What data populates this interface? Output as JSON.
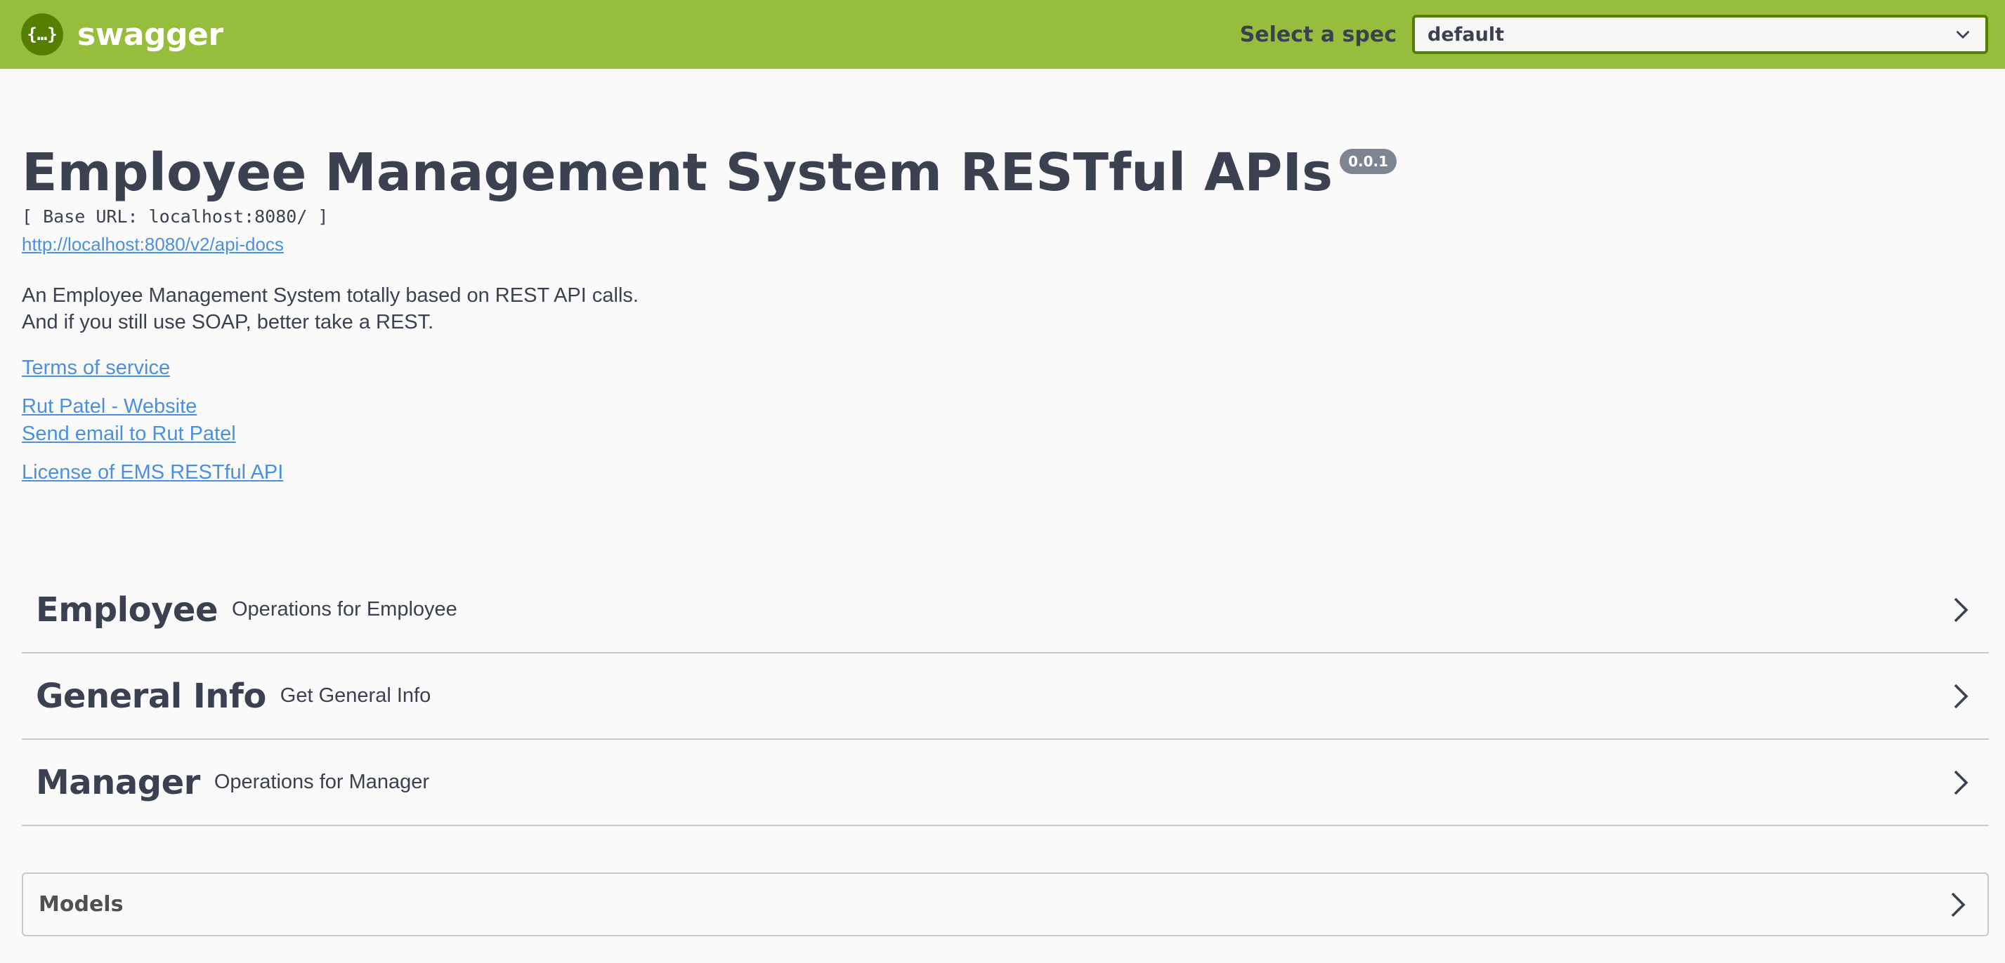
{
  "topbar": {
    "brand": "swagger",
    "logo_text": "{…}",
    "spec_label": "Select a spec",
    "spec_selected": "default"
  },
  "info": {
    "title": "Employee Management System RESTful APIs",
    "version": "0.0.1",
    "base_url": "[ Base URL: localhost:8080/ ]",
    "docs_link": "http://localhost:8080/v2/api-docs",
    "description_line1": "An Employee Management System totally based on REST API calls.",
    "description_line2": "And if you still use SOAP, better take a REST.",
    "terms": "Terms of service",
    "contact_website": "Rut Patel - Website",
    "contact_email": "Send email to Rut Patel",
    "license": "License of EMS RESTful API"
  },
  "tags": [
    {
      "name": "Employee",
      "description": "Operations for Employee"
    },
    {
      "name": "General Info",
      "description": "Get General Info"
    },
    {
      "name": "Manager",
      "description": "Operations for Manager"
    }
  ],
  "models": {
    "title": "Models"
  },
  "colors": {
    "topbar": "#97bd3c",
    "logo_bg": "#547f00",
    "link": "#4990e2",
    "text": "#3b4151",
    "version_badge": "#7d8492"
  }
}
